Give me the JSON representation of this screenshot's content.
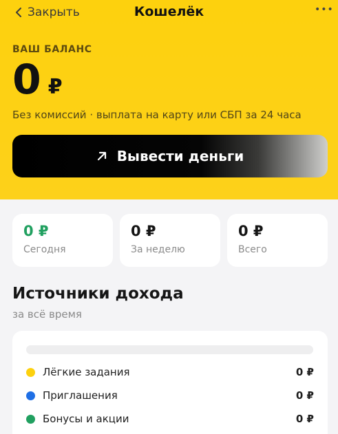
{
  "header": {
    "close_label": "Закрыть",
    "title": "Кошелёк",
    "more_icon": "more-horizontal-icon"
  },
  "balance": {
    "label": "ВАШ БАЛАНС",
    "amount": "0",
    "currency": "₽",
    "note": "Без комиссий · выплата на карту или СБП за 24 часа"
  },
  "withdraw": {
    "label": "Вывести деньги",
    "icon": "arrow-up-right-icon"
  },
  "stats": [
    {
      "value": "0 ₽",
      "label": "Сегодня",
      "color": "#21a060"
    },
    {
      "value": "0 ₽",
      "label": "За неделю",
      "color": "#151515"
    },
    {
      "value": "0 ₽",
      "label": "Всего",
      "color": "#151515"
    }
  ],
  "income": {
    "title": "Источники дохода",
    "subtitle": "за всё время",
    "progress_fraction": 0,
    "sources": [
      {
        "label": "Лёгкие задания",
        "value": "0 ₽",
        "color": "#fdd10e"
      },
      {
        "label": "Приглашения",
        "value": "0 ₽",
        "color": "#1f6fe5"
      },
      {
        "label": "Бонусы и акции",
        "value": "0 ₽",
        "color": "#21a060"
      }
    ]
  },
  "colors": {
    "accent_yellow": "#fdd10e",
    "button_black": "#000000",
    "positive_green": "#21a060"
  }
}
